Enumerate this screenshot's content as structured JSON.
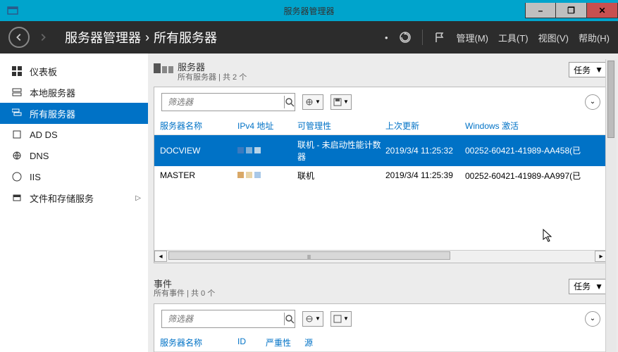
{
  "titlebar": {
    "title": "服务器管理器"
  },
  "header": {
    "breadcrumb_root": "服务器管理器",
    "breadcrumb_sep": "•",
    "breadcrumb_leaf": "所有服务器",
    "menu_manage": "管理(M)",
    "menu_tools": "工具(T)",
    "menu_view": "视图(V)",
    "menu_help": "帮助(H)"
  },
  "sidebar": {
    "items": [
      {
        "label": "仪表板"
      },
      {
        "label": "本地服务器"
      },
      {
        "label": "所有服务器"
      },
      {
        "label": "AD DS"
      },
      {
        "label": "DNS"
      },
      {
        "label": "IIS"
      },
      {
        "label": "文件和存储服务"
      }
    ]
  },
  "servers_panel": {
    "title": "服务器",
    "subtitle": "所有服务器 | 共 2 个",
    "tasks_label": "任务",
    "filter_placeholder": "筛选器",
    "columns": {
      "name": "服务器名称",
      "ip": "IPv4 地址",
      "manage": "可管理性",
      "updated": "上次更新",
      "activation": "Windows 激活"
    },
    "rows": [
      {
        "name": "DOCVIEW",
        "manage": "联机 - 未启动性能计数器",
        "updated": "2019/3/4 11:25:32",
        "activation": "00252-60421-41989-AA458(已"
      },
      {
        "name": "MASTER",
        "manage": "联机",
        "updated": "2019/3/4 11:25:39",
        "activation": "00252-60421-41989-AA997(已"
      }
    ]
  },
  "events_panel": {
    "title": "事件",
    "subtitle": "所有事件 | 共 0 个",
    "tasks_label": "任务",
    "filter_placeholder": "筛选器",
    "columns": {
      "name": "服务器名称",
      "id": "ID",
      "severity": "严重性",
      "source": "源"
    }
  },
  "colors": {
    "brand_blue": "#0072c6",
    "title_cyan": "#00a4cc",
    "header_dark": "#2c2c2c",
    "close_red": "#c75050"
  }
}
